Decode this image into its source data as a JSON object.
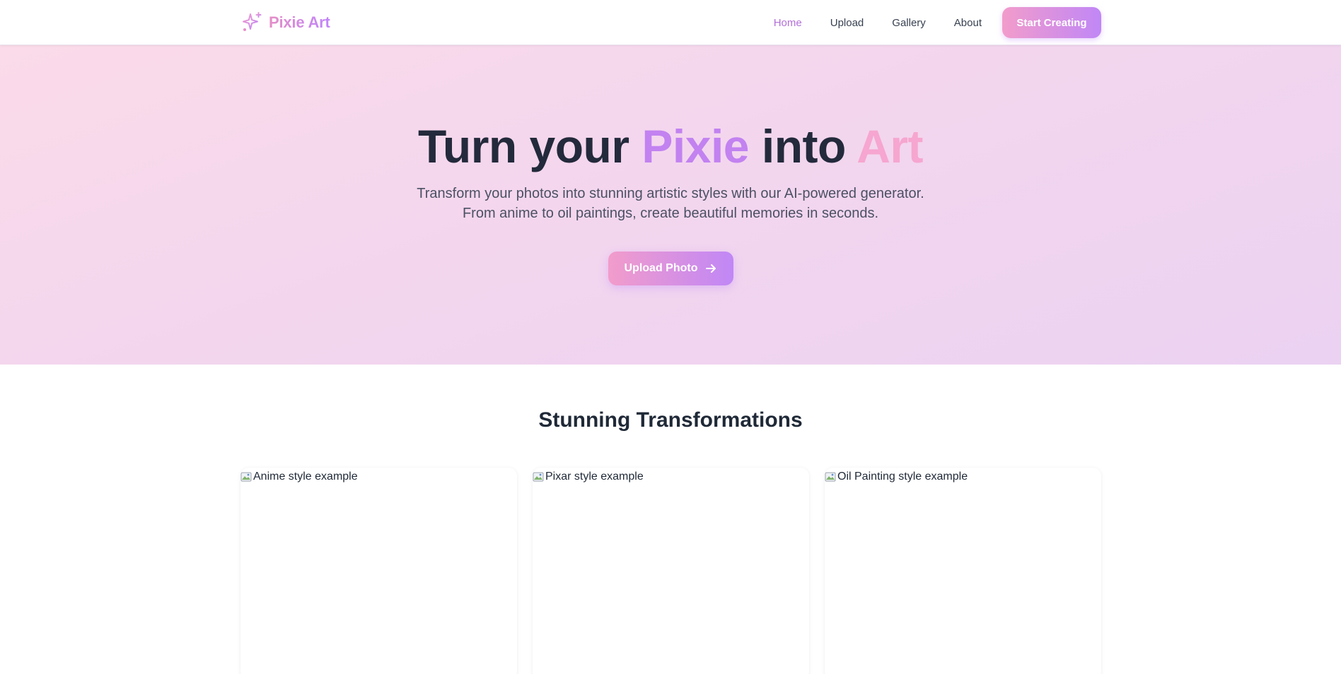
{
  "nav": {
    "brand": "Pixie Art",
    "links": [
      "Home",
      "Upload",
      "Gallery",
      "About"
    ],
    "active_index": 0,
    "cta": "Start Creating"
  },
  "hero": {
    "title_part1": "Turn your ",
    "title_highlight1": "Pixie",
    "title_part2": " into ",
    "title_highlight2": "Art",
    "subtitle_line1": "Transform your photos into stunning artistic styles with our AI-powered generator.",
    "subtitle_line2": "From anime to oil paintings, create beautiful memories in seconds.",
    "button": "Upload Photo"
  },
  "section": {
    "title": "Stunning Transformations",
    "cards": [
      {
        "alt": "Anime style example"
      },
      {
        "alt": "Pixar style example"
      },
      {
        "alt": "Oil Painting style example"
      }
    ]
  },
  "colors": {
    "accent_pink": "#f6a6d0",
    "accent_purple": "#c282f0",
    "text_dark": "#232a3b"
  },
  "icons": {
    "brand": "sparkles-icon",
    "hero_button": "arrow-right-icon",
    "card_image": "broken-image-icon"
  }
}
